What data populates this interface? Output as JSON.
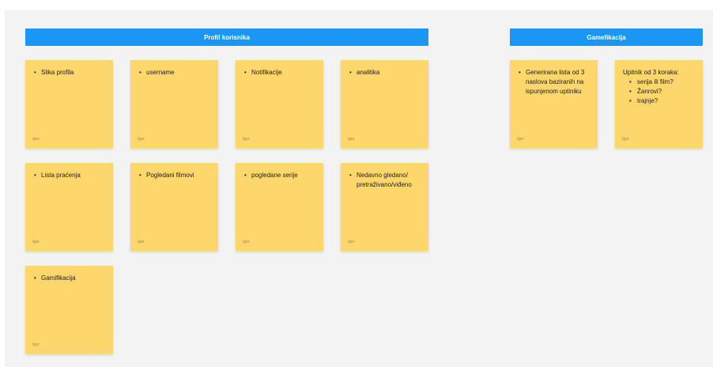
{
  "sections": {
    "profil": {
      "title": "Profil korisnika"
    },
    "gamifikacija": {
      "title": "Gamefikacija"
    }
  },
  "notes": [
    {
      "id": "slika-profila",
      "items": [
        "Slika profila"
      ],
      "author": "Igor"
    },
    {
      "id": "username",
      "items": [
        "username"
      ],
      "author": "Igor"
    },
    {
      "id": "notifikacije",
      "items": [
        "Notifikacije"
      ],
      "author": "Igor"
    },
    {
      "id": "analitika",
      "items": [
        "analitika"
      ],
      "author": "Igor"
    },
    {
      "id": "lista-pracenja",
      "items": [
        "Lista praćenja"
      ],
      "author": "Igor"
    },
    {
      "id": "pogledani-filmovi",
      "items": [
        "Pogledani filmovi"
      ],
      "author": "Igor"
    },
    {
      "id": "pogledane-serije",
      "items": [
        "pogledane serije"
      ],
      "author": "Igor"
    },
    {
      "id": "nedavno-gledano",
      "items": [
        "Nedavno gledano/ pretraživano/viđeno"
      ],
      "author": "Igor"
    },
    {
      "id": "gamifikacija",
      "items": [
        "Gamifikacija"
      ],
      "author": "Igor"
    },
    {
      "id": "generirana-lista",
      "items": [
        "Generirana lista od 3 naslova baziranih na ispunjenom uptiniku"
      ],
      "author": "Igor"
    },
    {
      "id": "upitnik",
      "heading": "Upitnik od 3 koraka:",
      "items": [
        "serija ili film?",
        "Žanrovi?",
        "trajnje?"
      ],
      "author": "Igor"
    }
  ]
}
